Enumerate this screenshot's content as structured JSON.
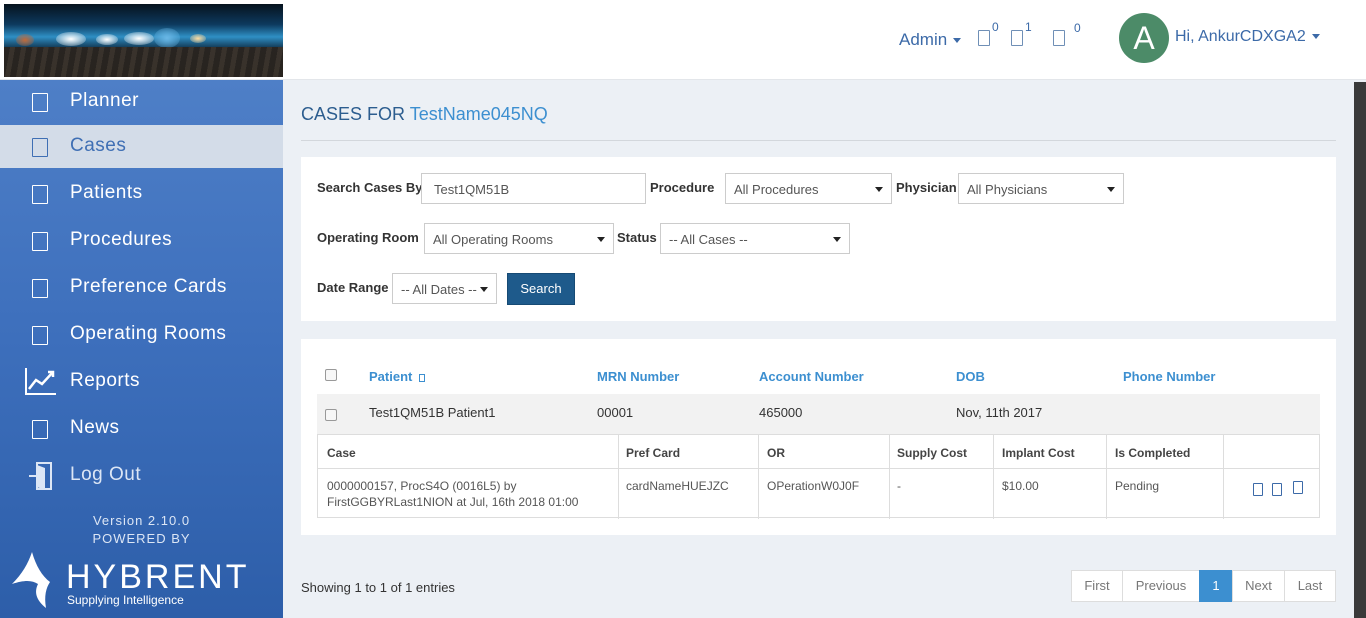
{
  "header": {
    "admin_label": "Admin",
    "badges": [
      "0",
      "1",
      "0"
    ],
    "avatar_letter": "A",
    "user_greeting": "Hi, AnkurCDXGA2"
  },
  "sidebar": {
    "items": [
      {
        "label": "Planner",
        "icon": "calendar-icon"
      },
      {
        "label": "Cases",
        "icon": "briefcase-icon"
      },
      {
        "label": "Patients",
        "icon": "user-icon"
      },
      {
        "label": "Procedures",
        "icon": "procedure-icon"
      },
      {
        "label": "Preference Cards",
        "icon": "card-icon"
      },
      {
        "label": "Operating Rooms",
        "icon": "room-icon"
      },
      {
        "label": "Reports",
        "icon": "chart-line-icon"
      },
      {
        "label": "News",
        "icon": "news-icon"
      },
      {
        "label": "Log Out",
        "icon": "logout-door-icon"
      }
    ],
    "version": "Version 2.10.0",
    "powered_by": "POWERED BY",
    "brand": "HYBRENT",
    "tagline": "Supplying Intelligence"
  },
  "page": {
    "title_prefix": "CASES FOR",
    "title_name": "TestName045NQ"
  },
  "search": {
    "search_by_label": "Search Cases By",
    "search_value": "Test1QM51B",
    "procedure_label": "Procedure",
    "procedure_value": "All Procedures",
    "physician_label": "Physician",
    "physician_value": "All Physicians",
    "or_label": "Operating Room",
    "or_value": "All Operating Rooms",
    "status_label": "Status",
    "status_value": "-- All Cases --",
    "date_label": "Date Range",
    "date_value": "-- All Dates --",
    "search_button": "Search"
  },
  "table": {
    "headers": {
      "patient": "Patient",
      "sort_icon": "sort-icon",
      "mrn": "MRN Number",
      "account": "Account Number",
      "dob": "DOB",
      "phone": "Phone Number"
    },
    "rows": [
      {
        "patient": "Test1QM51B Patient1",
        "mrn": "00001",
        "account": "465000",
        "dob": "Nov, 11th 2017",
        "phone": ""
      }
    ],
    "case_headers": {
      "case": "Case",
      "pref_card": "Pref Card",
      "or": "OR",
      "supply_cost": "Supply Cost",
      "implant_cost": "Implant Cost",
      "is_completed": "Is Completed"
    },
    "cases": [
      {
        "case_line1": "0000000157, ProcS4O (0016L5) by",
        "case_line2": "FirstGGBYRLast1NION at Jul, 16th 2018 01:00",
        "pref_card": "cardNameHUEJZC",
        "or": "OPerationW0J0F",
        "supply_cost": "-",
        "implant_cost": "$10.00",
        "is_completed": "Pending",
        "actions": [
          "edit-icon",
          "view-icon",
          "delete-icon"
        ]
      }
    ]
  },
  "footer": {
    "showing": "Showing 1 to 1 of 1 entries",
    "pager": [
      "First",
      "Previous",
      "1",
      "Next",
      "Last"
    ],
    "active_page": "1"
  },
  "colors": {
    "sidebar_blue": "#3e70bd",
    "link_blue": "#3c8fd0",
    "button_dark_blue": "#1e5a8b",
    "avatar_green": "#4c8b68"
  }
}
